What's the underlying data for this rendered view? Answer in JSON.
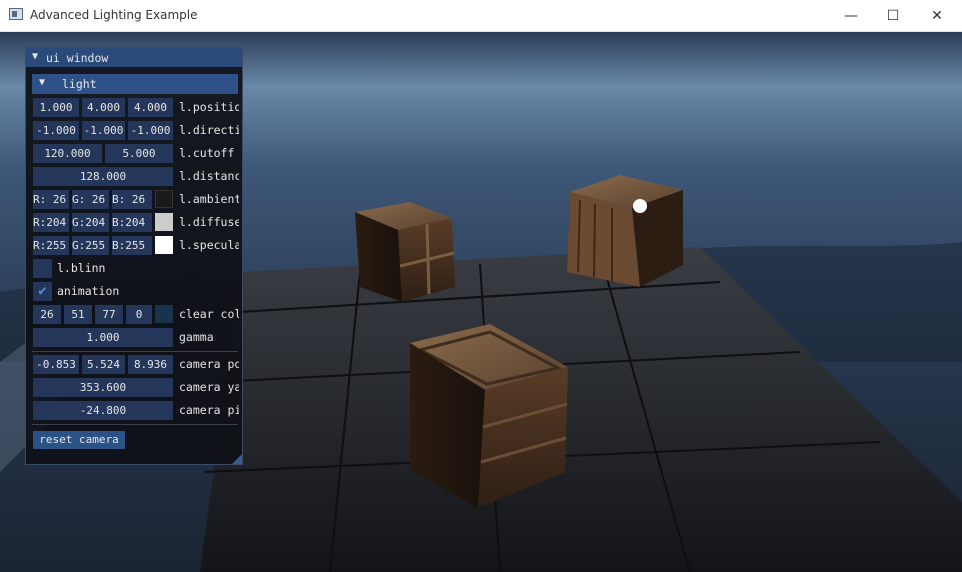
{
  "window": {
    "title": "Advanced Lighting Example",
    "minimize_glyph": "—",
    "maximize_glyph": "☐",
    "close_glyph": "✕"
  },
  "ui": {
    "title": "ui window",
    "collapse_glyph": "▼",
    "light_header": "light",
    "light_position": [
      "1.000",
      "4.000",
      "4.000"
    ],
    "light_position_label": "l.position",
    "light_direction": [
      "-1.000",
      "-1.000",
      "-1.000"
    ],
    "light_direction_label": "l.direction",
    "light_cutoff": [
      "120.000",
      "5.000"
    ],
    "light_cutoff_label": "l.cutoff",
    "light_distance": "128.000",
    "light_distance_label": "l.distance",
    "ambient": [
      "R: 26",
      "G: 26",
      "B: 26"
    ],
    "ambient_label": "l.ambient",
    "ambient_color": "#1a1a1a",
    "diffuse": [
      "R:204",
      "G:204",
      "B:204"
    ],
    "diffuse_label": "l.diffuse",
    "diffuse_color": "#cccccc",
    "specular": [
      "R:255",
      "G:255",
      "B:255"
    ],
    "specular_label": "l.specular",
    "specular_color": "#ffffff",
    "blinn_label": "l.blinn",
    "blinn_checked": false,
    "animation_label": "animation",
    "animation_checked": true,
    "clear_color": [
      "26",
      "51",
      "77",
      "0"
    ],
    "clear_color_label": "clear color",
    "clear_color_swatch": "#1a334d",
    "gamma": "1.000",
    "gamma_label": "gamma",
    "camera_pos": [
      "-0.853",
      "5.524",
      "8.936"
    ],
    "camera_pos_label": "camera pos",
    "camera_yaw": "353.600",
    "camera_yaw_label": "camera yaw",
    "camera_pitch": "-24.800",
    "camera_pitch_label": "camera pitch",
    "reset_camera": "reset camera",
    "check_glyph": "✔"
  },
  "colors": {
    "accent": "#2e5287",
    "frame_bg": "#24365a",
    "title_bg": "#294a7a"
  }
}
